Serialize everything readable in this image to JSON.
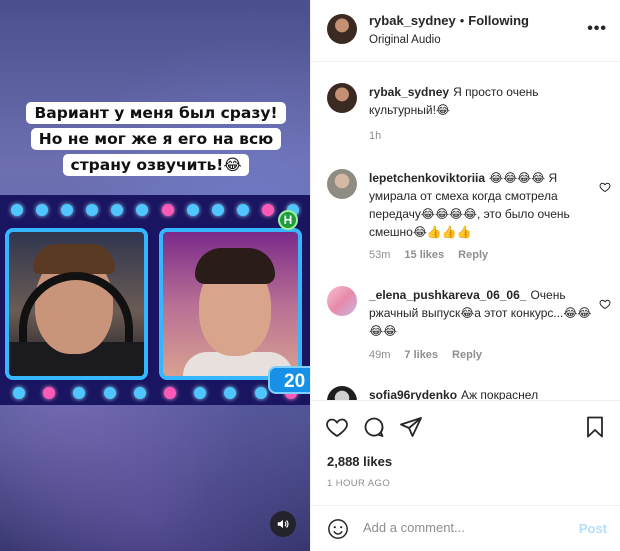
{
  "video": {
    "caption_lines": [
      "Вариант у меня был сразу!",
      "Но не мог же я его на всю",
      "страну озвучить!😂"
    ],
    "badge_letter": "Н",
    "score": "20",
    "sound_icon": "speaker-icon"
  },
  "header": {
    "username": "rybak_sydney",
    "separator": "•",
    "follow_status": "Following",
    "audio": "Original Audio",
    "more_icon": "•••"
  },
  "comments": [
    {
      "username": "rybak_sydney",
      "text": "Я просто очень культурный!😂",
      "time": "1h",
      "likes": "",
      "reply": ""
    },
    {
      "username": "lepetchenkoviktoriia",
      "text": "😂😂😂😂 Я умирала от смеха когда смотрела передачу😂😂😂😂, это было очень смешно😂👍👍👍",
      "time": "53m",
      "likes": "15 likes",
      "reply": "Reply"
    },
    {
      "username": "_elena_pushkareva_06_06_",
      "text": "Очень ржачный выпуск😂а этот конкурс...😂😂😂😂",
      "time": "49m",
      "likes": "7 likes",
      "reply": "Reply"
    },
    {
      "username": "sofia96rydenko",
      "text": "Аж покраснел",
      "time": "",
      "likes": "",
      "reply": ""
    }
  ],
  "actions": {
    "like_icon": "heart-icon",
    "comment_icon": "comment-icon",
    "share_icon": "send-icon",
    "save_icon": "bookmark-icon"
  },
  "likes_count": "2,888 likes",
  "posted": "1 HOUR AGO",
  "comment_box": {
    "placeholder": "Add a comment...",
    "post_label": "Post"
  },
  "colors": {
    "post_button_disabled": "#b2dffc",
    "muted_text": "#8e8e8e",
    "border": "#efefef",
    "screen_frame": "#36b6ff"
  }
}
